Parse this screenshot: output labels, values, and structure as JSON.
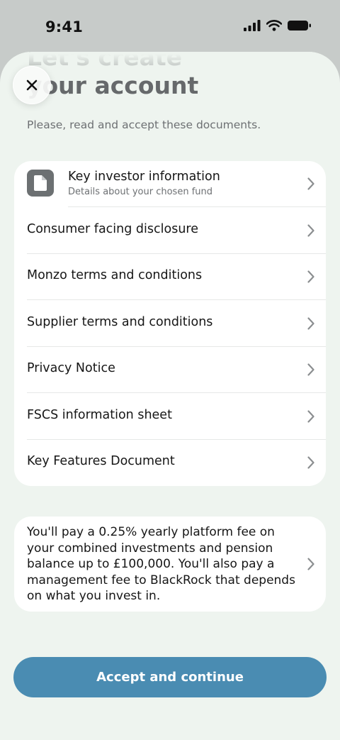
{
  "status_bar": {
    "time": "9:41",
    "icons": [
      "cellular-signal-icon",
      "wifi-icon",
      "battery-icon"
    ]
  },
  "header": {
    "title": "Let's create\nyour account",
    "close_icon": "close-icon",
    "subtitle": "Please, read and accept these documents."
  },
  "documents": {
    "first_item": {
      "icon": "document-icon",
      "title": "Key investor information",
      "description": "Details about your chosen fund"
    },
    "items": [
      {
        "label": "Consumer facing disclosure"
      },
      {
        "label": "Monzo terms and conditions"
      },
      {
        "label": "Supplier terms and conditions"
      },
      {
        "label": "Privacy Notice"
      },
      {
        "label": "FSCS information sheet"
      },
      {
        "label": "Key Features Document"
      }
    ]
  },
  "fee_notice": {
    "text": "You'll pay a 0.25% yearly platform fee on your combined investments and pension balance up to £100,000. You'll also pay a management fee to BlackRock that depends on what you invest in."
  },
  "footer": {
    "accept_label": "Accept and continue"
  },
  "colors": {
    "background": "#eef4ef",
    "accent": "#4a8cb2",
    "card": "#ffffff",
    "icon_tile": "#6c7072"
  }
}
